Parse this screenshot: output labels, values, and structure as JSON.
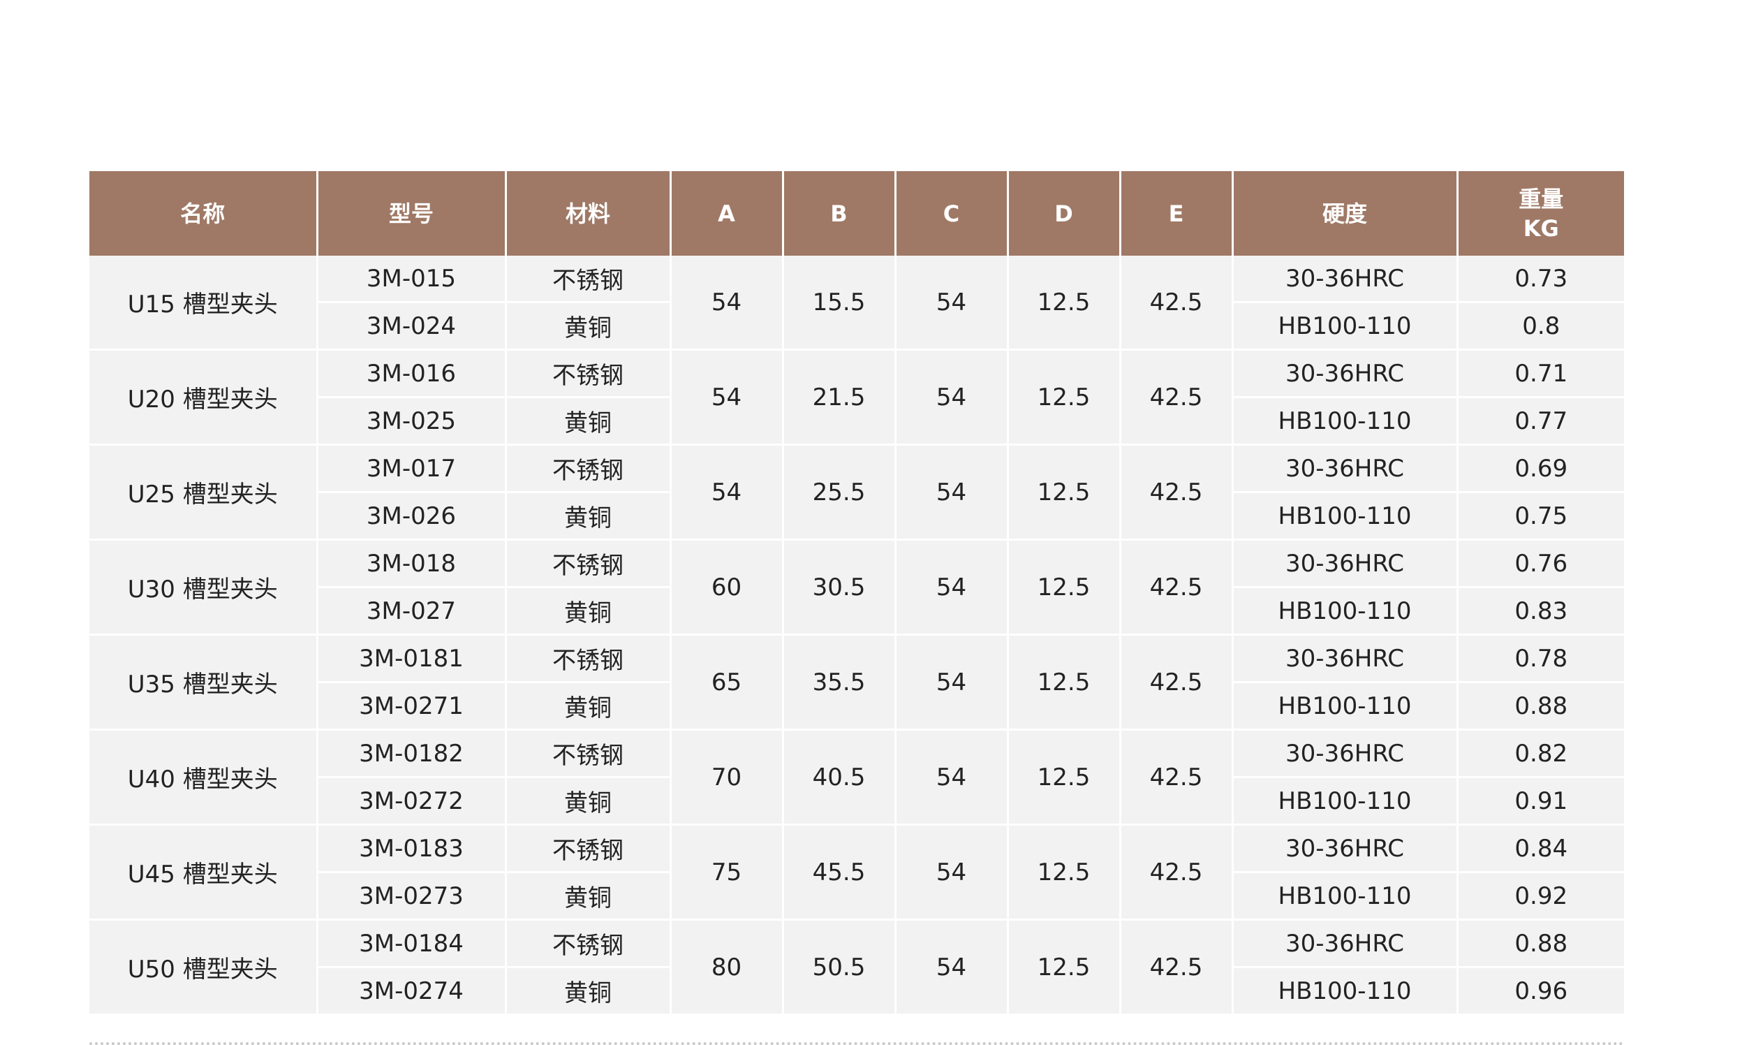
{
  "table": {
    "headers": {
      "name": "名称",
      "model": "型号",
      "material": "材料",
      "a": "A",
      "b": "B",
      "c": "C",
      "d": "D",
      "e": "E",
      "hardness": "硬度",
      "weight_line1": "重量",
      "weight_line2": "KG"
    },
    "groups": [
      {
        "name": "U15 槽型夹头",
        "a": "54",
        "b": "15.5",
        "c": "54",
        "d": "12.5",
        "e": "42.5",
        "rows": [
          {
            "model": "3M-015",
            "material": "不锈钢",
            "hardness": "30-36HRC",
            "weight": "0.73"
          },
          {
            "model": "3M-024",
            "material": "黄铜",
            "hardness": "HB100-110",
            "weight": "0.8"
          }
        ]
      },
      {
        "name": "U20 槽型夹头",
        "a": "54",
        "b": "21.5",
        "c": "54",
        "d": "12.5",
        "e": "42.5",
        "rows": [
          {
            "model": "3M-016",
            "material": "不锈钢",
            "hardness": "30-36HRC",
            "weight": "0.71"
          },
          {
            "model": "3M-025",
            "material": "黄铜",
            "hardness": "HB100-110",
            "weight": "0.77"
          }
        ]
      },
      {
        "name": "U25 槽型夹头",
        "a": "54",
        "b": "25.5",
        "c": "54",
        "d": "12.5",
        "e": "42.5",
        "rows": [
          {
            "model": "3M-017",
            "material": "不锈钢",
            "hardness": "30-36HRC",
            "weight": "0.69"
          },
          {
            "model": "3M-026",
            "material": "黄铜",
            "hardness": "HB100-110",
            "weight": "0.75"
          }
        ]
      },
      {
        "name": "U30 槽型夹头",
        "a": "60",
        "b": "30.5",
        "c": "54",
        "d": "12.5",
        "e": "42.5",
        "rows": [
          {
            "model": "3M-018",
            "material": "不锈钢",
            "hardness": "30-36HRC",
            "weight": "0.76"
          },
          {
            "model": "3M-027",
            "material": "黄铜",
            "hardness": "HB100-110",
            "weight": "0.83"
          }
        ]
      },
      {
        "name": "U35 槽型夹头",
        "a": "65",
        "b": "35.5",
        "c": "54",
        "d": "12.5",
        "e": "42.5",
        "rows": [
          {
            "model": "3M-0181",
            "material": "不锈钢",
            "hardness": "30-36HRC",
            "weight": "0.78"
          },
          {
            "model": "3M-0271",
            "material": "黄铜",
            "hardness": "HB100-110",
            "weight": "0.88"
          }
        ]
      },
      {
        "name": "U40 槽型夹头",
        "a": "70",
        "b": "40.5",
        "c": "54",
        "d": "12.5",
        "e": "42.5",
        "rows": [
          {
            "model": "3M-0182",
            "material": "不锈钢",
            "hardness": "30-36HRC",
            "weight": "0.82"
          },
          {
            "model": "3M-0272",
            "material": "黄铜",
            "hardness": "HB100-110",
            "weight": "0.91"
          }
        ]
      },
      {
        "name": "U45 槽型夹头",
        "a": "75",
        "b": "45.5",
        "c": "54",
        "d": "12.5",
        "e": "42.5",
        "rows": [
          {
            "model": "3M-0183",
            "material": "不锈钢",
            "hardness": "30-36HRC",
            "weight": "0.84"
          },
          {
            "model": "3M-0273",
            "material": "黄铜",
            "hardness": "HB100-110",
            "weight": "0.92"
          }
        ]
      },
      {
        "name": "U50 槽型夹头",
        "a": "80",
        "b": "50.5",
        "c": "54",
        "d": "12.5",
        "e": "42.5",
        "rows": [
          {
            "model": "3M-0184",
            "material": "不锈钢",
            "hardness": "30-36HRC",
            "weight": "0.88"
          },
          {
            "model": "3M-0274",
            "material": "黄铜",
            "hardness": "HB100-110",
            "weight": "0.96"
          }
        ]
      }
    ]
  },
  "colors": {
    "header_bg": "#9f7966",
    "header_text": "#ffffff",
    "cell_bg": "#f2f2f2",
    "cell_text": "#222222"
  }
}
